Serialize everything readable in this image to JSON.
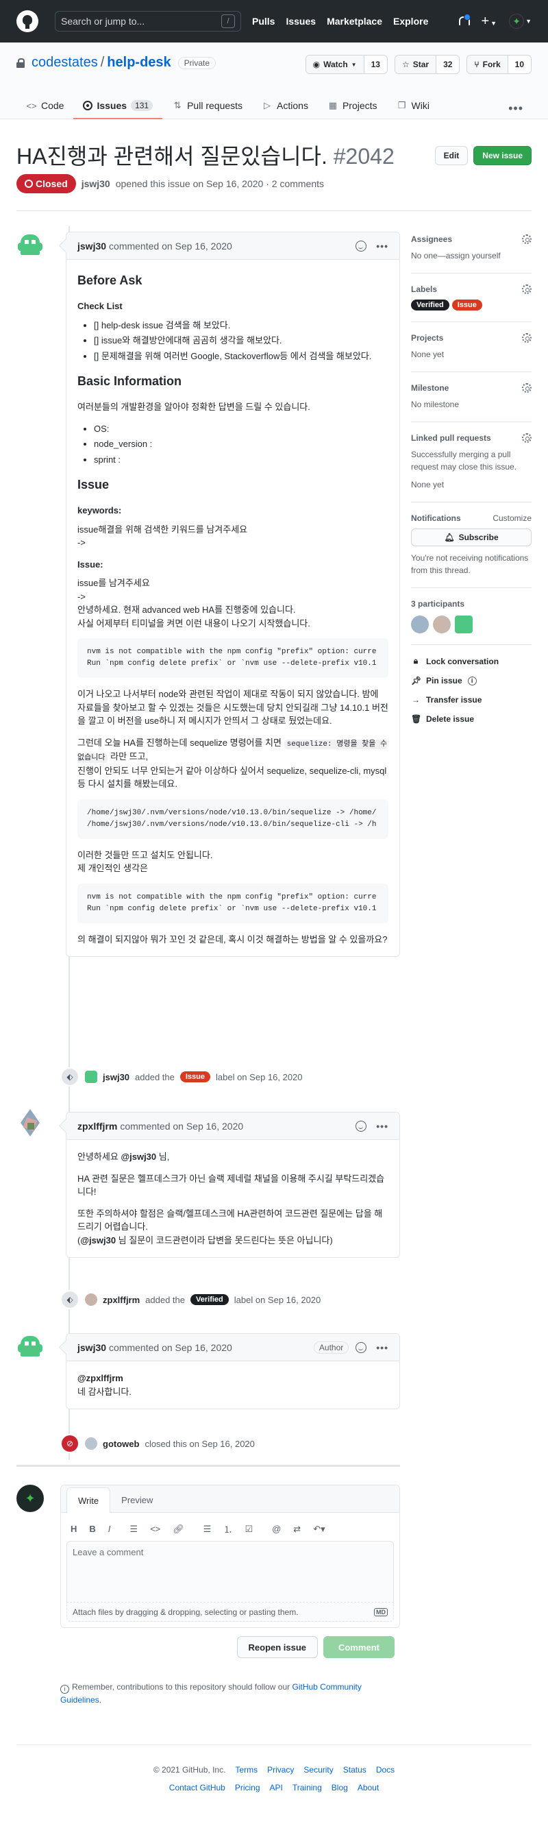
{
  "header": {
    "search_placeholder": "Search or jump to...",
    "search_key": "/",
    "nav": [
      "Pulls",
      "Issues",
      "Marketplace",
      "Explore"
    ]
  },
  "repo": {
    "owner": "codestates",
    "separator": "/",
    "name": "help-desk",
    "visibility": "Private",
    "watch_label": "Watch",
    "watch_count": "13",
    "star_label": "Star",
    "star_count": "32",
    "fork_label": "Fork",
    "fork_count": "10",
    "tabs": [
      {
        "label": "Code",
        "icon": "code-icon"
      },
      {
        "label": "Issues",
        "icon": "issue-icon",
        "count": "131"
      },
      {
        "label": "Pull requests",
        "icon": "pull-request-icon"
      },
      {
        "label": "Actions",
        "icon": "play-icon"
      },
      {
        "label": "Projects",
        "icon": "project-icon"
      },
      {
        "label": "Wiki",
        "icon": "book-icon"
      }
    ]
  },
  "issue": {
    "title": "HA진행과 관련해서 질문있습니다.",
    "number": "#2042",
    "edit_label": "Edit",
    "new_issue_label": "New issue",
    "state": "Closed",
    "author": "jswj30",
    "meta": "opened this issue on Sep 16, 2020 · 2 comments"
  },
  "comments": {
    "first": {
      "author": "jswj30",
      "time": "commented on Sep 16, 2020",
      "h_before": "Before Ask",
      "h_checklist": "Check List",
      "checklist": [
        "[] help-desk issue 검색을 해 보았다.",
        "[] issue와 해결방안에대해 곰곰히 생각을 해보았다.",
        "[] 문제해결을 위해 여러번 Google, Stackoverflow등 에서 검색을 해보았다."
      ],
      "h_basic": "Basic Information",
      "basic_text": "여러분들의 개발환경을 알아야 정확한 답변을 드릴 수 있습니다.",
      "basic_list": [
        "OS:",
        "node_version :",
        "sprint :"
      ],
      "h_issue": "Issue",
      "h_keywords": "keywords:",
      "keywords_text1": "issue해결을 위해 검색한 키워드를 남겨주세요",
      "keywords_text2": "->",
      "h_issue2": "Issue:",
      "issue_text1": "issue를 남겨주세요",
      "issue_text2": "->",
      "issue_text3": "안녕하세요. 현재 advanced web HA를 진행중에 있습니다.",
      "issue_text4": "사실 어제부터 티미널을 켜면 이런 내용이 나오기 시작했습니다.",
      "code1": "nvm is not compatible with the npm config \"prefix\" option: curre\nRun `npm config delete prefix` or `nvm use --delete-prefix v10.1",
      "para1": "이거 나오고 나서부터 node와 관련된 작업이 제대로 작동이 되지 않았습니다. 밤에 자료들을 찾아보고 할 수 있겠는 것들은 시도했는데 당치 안되길래 그냥 14.10.1 버전을 깔고 이 버전을 use하니 저 메시지가 안띄서 그 상태로 뒀었는데요.",
      "para2_a": "그런데 오늘 HA를 진행하는데 sequelize 명령어를 치면",
      "para2_code": "sequelize: 명령을 찾을 수 없습니다",
      "para2_b": "라만 뜨고,",
      "para2_c": "진행이 안되도 너무 안되는거 같아 이상하다 싶어서 sequelize, sequelize-cli, mysql 등 다시 설치를 해봤는데요.",
      "code2": "/home/jswj30/.nvm/versions/node/v10.13.0/bin/sequelize -> /home/\n/home/jswj30/.nvm/versions/node/v10.13.0/bin/sequelize-cli -> /h",
      "para3_a": "이러한 것들만 뜨고 설치도 안됩니다.",
      "para3_b": "제 개인적인 생각은",
      "code3": "nvm is not compatible with the npm config \"prefix\" option: curre\nRun `npm config delete prefix` or `nvm use --delete-prefix v10.1",
      "para4": "의 해결이 되지않아 뭐가 꼬인 것 같은데, 혹시 이것 해결하는 방법을 알 수 있을까요?"
    },
    "second": {
      "author": "zpxlffjrm",
      "time": "commented on Sep 16, 2020",
      "line1_a": "안녕하세요",
      "line1_mention": "@jswj30",
      "line1_b": "님,",
      "line2": "HA 관련 질문은 헬프데스크가 아닌 슬랙 제네럴 채널을 이용해 주시길 부탁드리겠습니다!",
      "line3": "또한 주의하셔야 할점은 슬랙/헬프데스크에 HA관련하여 코드관련 질문에는 답을 해드리기 어렵습니다.",
      "line4_a": "(",
      "line4_mention": "@jswj30",
      "line4_b": "님 질문이 코드관련이라 답변을 못드린다는 뜻은 아닙니다)"
    },
    "third": {
      "author": "jswj30",
      "time": "commented on Sep 16, 2020",
      "badge": "Author",
      "mention": "@zpxlffjrm",
      "text": "네 감사합니다."
    }
  },
  "events": {
    "label_added1": {
      "user": "jswj30",
      "action": "added the",
      "label": "Issue",
      "time": "label on Sep 16, 2020"
    },
    "label_added2": {
      "user": "zpxlffjrm",
      "action": "added the",
      "label": "Verified",
      "time": "label on Sep 16, 2020"
    },
    "closed": {
      "user": "gotoweb",
      "text": "closed this on Sep 16, 2020"
    }
  },
  "sidebar": {
    "assignees_title": "Assignees",
    "assignees_value": "No one—assign yourself",
    "labels_title": "Labels",
    "labels": [
      {
        "name": "Verified",
        "color": "#1b1f23"
      },
      {
        "name": "Issue",
        "color": "#d73a1e"
      }
    ],
    "projects_title": "Projects",
    "projects_value": "None yet",
    "milestone_title": "Milestone",
    "milestone_value": "No milestone",
    "linked_title": "Linked pull requests",
    "linked_desc": "Successfully merging a pull request may close this issue.",
    "linked_value": "None yet",
    "notifications_title": "Notifications",
    "customize": "Customize",
    "subscribe": "Subscribe",
    "notif_text": "You're not receiving notifications from this thread.",
    "participants_title": "3 participants",
    "lock": "Lock conversation",
    "pin": "Pin issue",
    "transfer": "Transfer issue",
    "delete": "Delete issue"
  },
  "editor": {
    "tab_write": "Write",
    "tab_preview": "Preview",
    "placeholder": "Leave a comment",
    "attach": "Attach files by dragging & dropping, selecting or pasting them.",
    "md_badge": "MD",
    "reopen": "Reopen issue",
    "comment": "Comment"
  },
  "guidelines": {
    "text": "Remember, contributions to this repository should follow our",
    "link": "GitHub Community Guidelines",
    "period": "."
  },
  "footer": {
    "row1": [
      "© 2021 GitHub, Inc.",
      "Terms",
      "Privacy",
      "Security",
      "Status",
      "Docs"
    ],
    "row2": [
      "Contact GitHub",
      "Pricing",
      "API",
      "Training",
      "Blog",
      "About"
    ]
  }
}
